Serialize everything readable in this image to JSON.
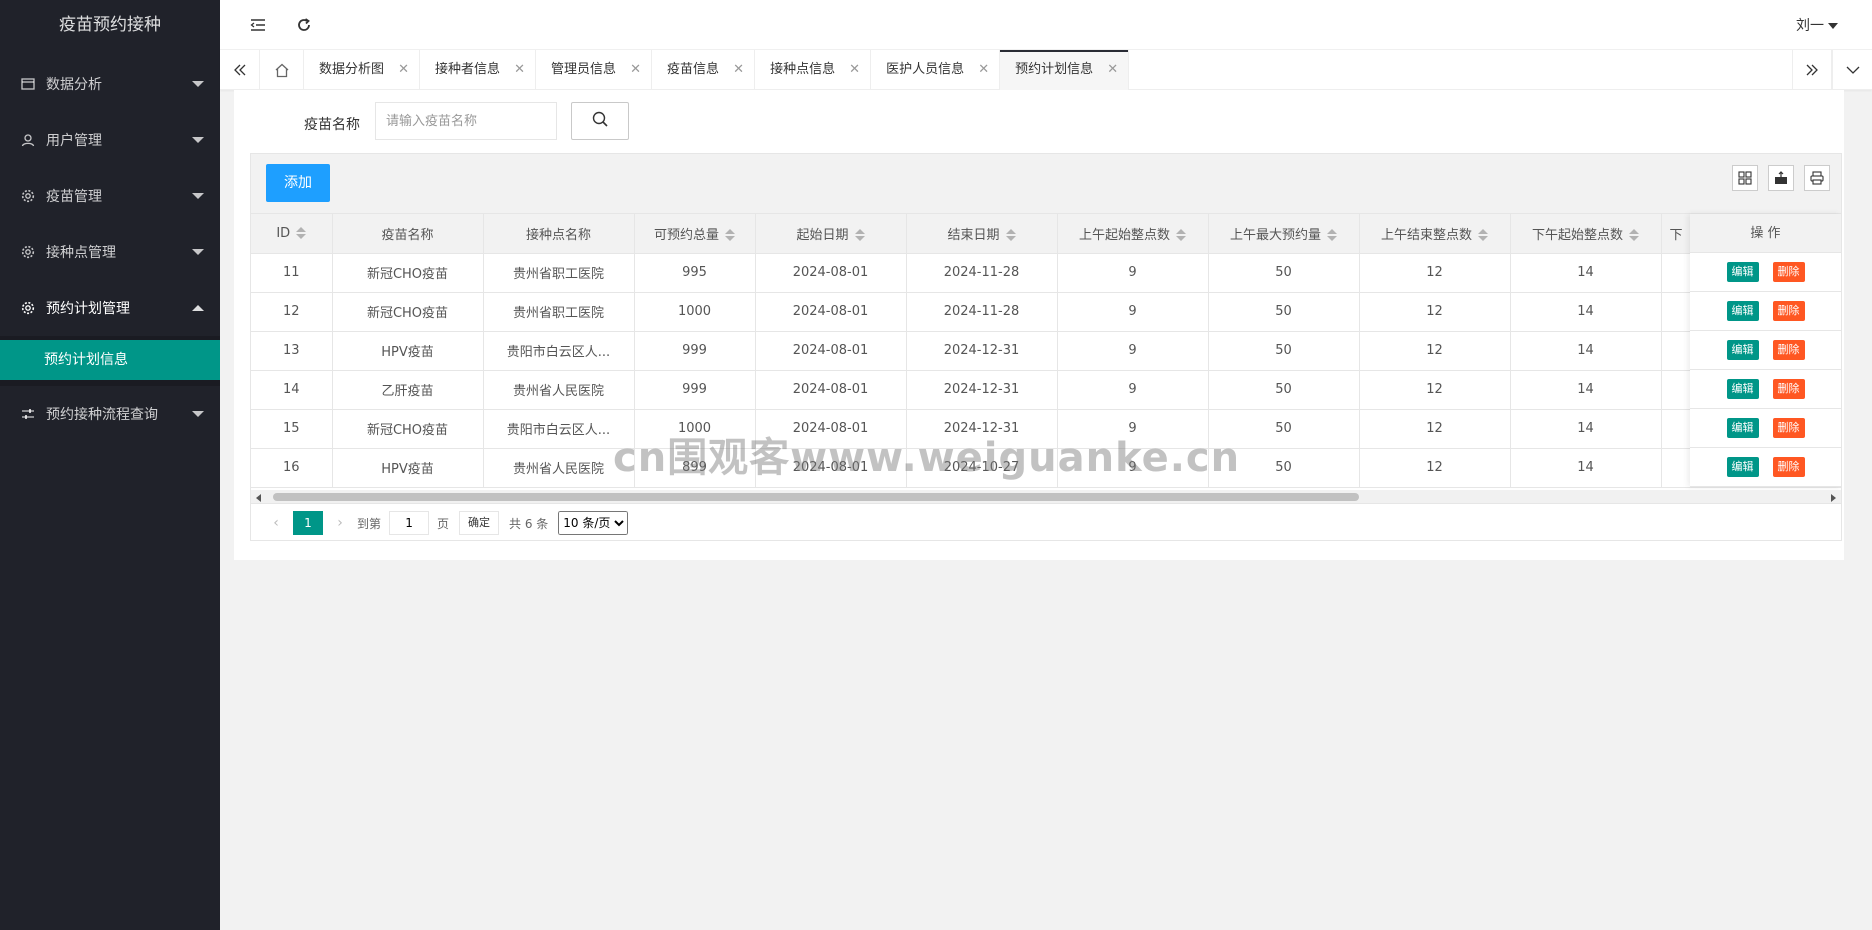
{
  "app": {
    "title": "疫苗预约接种"
  },
  "sidebar": {
    "items": [
      {
        "label": "数据分析",
        "icon": "calendar-icon"
      },
      {
        "label": "用户管理",
        "icon": "user-icon"
      },
      {
        "label": "疫苗管理",
        "icon": "gear-icon"
      },
      {
        "label": "接种点管理",
        "icon": "gear-icon"
      },
      {
        "label": "预约计划管理",
        "icon": "gear-icon"
      },
      {
        "label": "预约接种流程查询",
        "icon": "sliders-icon"
      }
    ],
    "sub_items": [
      {
        "label": "预约计划信息"
      }
    ]
  },
  "header": {
    "user_name": "刘一"
  },
  "tabs": [
    {
      "label": "数据分析图"
    },
    {
      "label": "接种者信息"
    },
    {
      "label": "管理员信息"
    },
    {
      "label": "疫苗信息"
    },
    {
      "label": "接种点信息"
    },
    {
      "label": "医护人员信息"
    },
    {
      "label": "预约计划信息"
    }
  ],
  "search": {
    "label": "疫苗名称",
    "placeholder": "请输入疫苗名称"
  },
  "toolbar": {
    "add_label": "添加"
  },
  "table": {
    "columns": [
      "ID",
      "疫苗名称",
      "接种点名称",
      "可预约总量",
      "起始日期",
      "结束日期",
      "上午起始整点数",
      "上午最大预约量",
      "上午结束整点数",
      "下午起始整点数",
      "下"
    ],
    "action_header": "操 作",
    "edit_label": "编辑",
    "delete_label": "删除",
    "rows": [
      [
        "11",
        "新冠CHO疫苗",
        "贵州省职工医院",
        "995",
        "2024-08-01",
        "2024-11-28",
        "9",
        "50",
        "12",
        "14",
        ""
      ],
      [
        "12",
        "新冠CHO疫苗",
        "贵州省职工医院",
        "1000",
        "2024-08-01",
        "2024-11-28",
        "9",
        "50",
        "12",
        "14",
        ""
      ],
      [
        "13",
        "HPV疫苗",
        "贵阳市白云区人...",
        "999",
        "2024-08-01",
        "2024-12-31",
        "9",
        "50",
        "12",
        "14",
        ""
      ],
      [
        "14",
        "乙肝疫苗",
        "贵州省人民医院",
        "999",
        "2024-08-01",
        "2024-12-31",
        "9",
        "50",
        "12",
        "14",
        ""
      ],
      [
        "15",
        "新冠CHO疫苗",
        "贵阳市白云区人...",
        "1000",
        "2024-08-01",
        "2024-12-31",
        "9",
        "50",
        "12",
        "14",
        ""
      ],
      [
        "16",
        "HPV疫苗",
        "贵州省人民医院",
        "899",
        "2024-08-01",
        "2024-10-27",
        "9",
        "50",
        "12",
        "14",
        ""
      ]
    ]
  },
  "pager": {
    "current": "1",
    "goto_label": "到第",
    "page_value": "1",
    "page_suffix": "页",
    "confirm_label": "确定",
    "total_text": "共 6 条",
    "page_size": "10 条/页"
  },
  "watermark": "cn围观客www.weiguanke.cn",
  "colors": {
    "sidebar_bg": "#20222a",
    "accent": "#009688",
    "add_btn": "#1e9fff",
    "delete_btn": "#ff5722"
  }
}
